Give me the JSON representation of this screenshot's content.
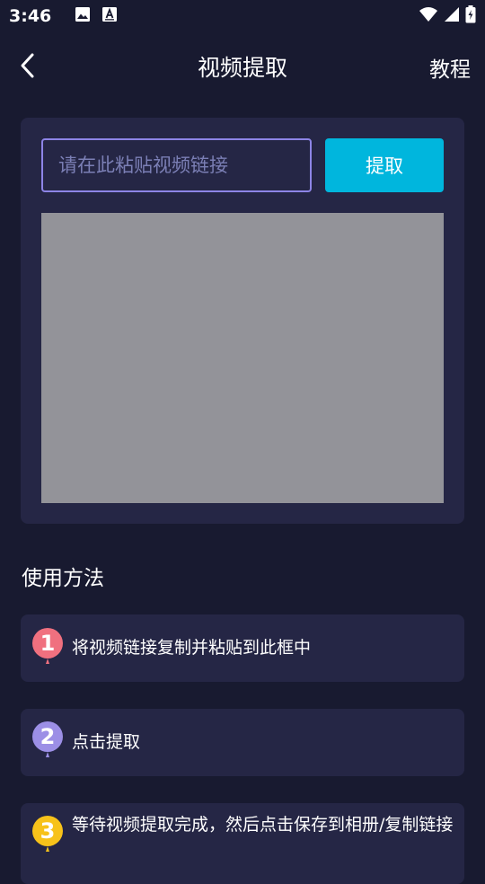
{
  "status_bar": {
    "time": "3:46",
    "left_icons": [
      "image-icon",
      "font-icon"
    ],
    "right_icons": [
      "wifi-icon",
      "signal-icon",
      "battery-icon"
    ]
  },
  "nav": {
    "title": "视频提取",
    "tutorial_label": "教程",
    "back_icon": "chevron-left-icon"
  },
  "extract": {
    "input_placeholder": "请在此粘贴视频链接",
    "input_value": "",
    "button_label": "提取"
  },
  "usage": {
    "title": "使用方法",
    "steps": [
      {
        "number": "1",
        "text": "将视频链接复制并粘贴到此框中",
        "color": "#f0707f"
      },
      {
        "number": "2",
        "text": "点击提取",
        "color": "#9c8fe6"
      },
      {
        "number": "3",
        "text": "等待视频提取完成，然后点击保存到相册/复制链接",
        "color": "#f7c21a"
      }
    ]
  },
  "colors": {
    "background": "#181a30",
    "card": "#252645",
    "accent": "#00b6dd",
    "input_border": "#8d84e6",
    "placeholder": "#7b7fb5",
    "preview": "#939399"
  }
}
